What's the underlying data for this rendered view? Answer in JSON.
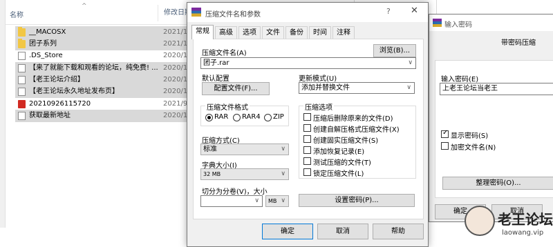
{
  "explorer": {
    "col_name": "名称",
    "col_date": "修改日期",
    "rows": [
      {
        "name": "__MACOSX",
        "date": "2021/1",
        "type": "folder",
        "selected": true
      },
      {
        "name": "团子系列",
        "date": "2021/1",
        "type": "folder",
        "selected": true
      },
      {
        "name": ".DS_Store",
        "date": "2020/1",
        "type": "file",
        "selected": false
      },
      {
        "name": "【来了就能下载和观看的论坛，纯免费! ...",
        "date": "2020/1",
        "type": "file",
        "selected": true
      },
      {
        "name": "【老王论坛介绍】",
        "date": "2020/1",
        "type": "file",
        "selected": true
      },
      {
        "name": "【老王论坛永久地址发布页】",
        "date": "2020/1",
        "type": "file",
        "selected": true
      },
      {
        "name": "20210926115720",
        "date": "2021/9",
        "type": "pdf",
        "selected": false
      },
      {
        "name": "获取最新地址",
        "date": "2020/1",
        "type": "file",
        "selected": true
      }
    ]
  },
  "dialog": {
    "title": "压缩文件名和参数",
    "help_glyph": "?",
    "close_glyph": "✕",
    "tabs": [
      "常规",
      "高级",
      "选项",
      "文件",
      "备份",
      "时间",
      "注释"
    ],
    "archive_name_label": "压缩文件名(A)",
    "browse_label": "浏览(B)...",
    "archive_name_value": "团子.rar",
    "default_config_label": "默认配置",
    "config_button": "配置文件(F)...",
    "update_mode_label": "更新模式(U)",
    "update_mode_value": "添加并替换文件",
    "format_group": "压缩文件格式",
    "formats": [
      {
        "label": "RAR",
        "on": true
      },
      {
        "label": "RAR4",
        "on": false
      },
      {
        "label": "ZIP",
        "on": false
      }
    ],
    "method_label": "压缩方式(C)",
    "method_value": "标准",
    "dict_label": "字典大小(I)",
    "dict_value": "32 MB",
    "split_label": "切分为分卷(V)，大小",
    "split_unit": "MB",
    "options_group": "压缩选项",
    "options": [
      {
        "label": "压缩后删除原来的文件(D)",
        "on": false
      },
      {
        "label": "创建自解压格式压缩文件(X)",
        "on": false
      },
      {
        "label": "创建固实压缩文件(S)",
        "on": false
      },
      {
        "label": "添加恢复记录(E)",
        "on": false
      },
      {
        "label": "测试压缩的文件(T)",
        "on": false
      },
      {
        "label": "锁定压缩文件(L)",
        "on": false
      }
    ],
    "set_password_button": "设置密码(P)...",
    "ok": "确定",
    "cancel": "取消",
    "help": "帮助"
  },
  "password_dialog": {
    "title": "输入密码",
    "subtitle": "带密码压缩",
    "input_label": "输入密码(E)",
    "input_value": "上老王论坛当老王",
    "show_password": {
      "label": "显示密码(S)",
      "on": true
    },
    "encrypt_names": {
      "label": "加密文件名(N)",
      "on": false
    },
    "organize_button": "整理密码(O)...",
    "ok": "确定",
    "cancel": "取消"
  },
  "watermark": {
    "brand": "老王论坛",
    "url": "laowang.vip"
  }
}
